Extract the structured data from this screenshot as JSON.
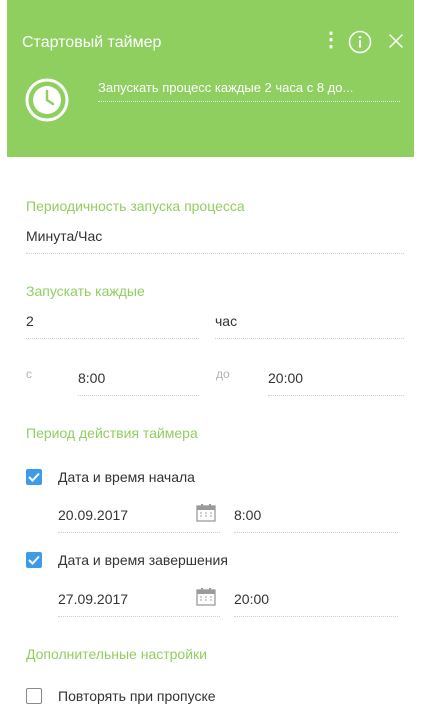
{
  "header": {
    "title": "Стартовый таймер",
    "description": "Запускать процесс каждые 2 часа с 8 до..."
  },
  "frequency": {
    "label": "Периодичность запуска процесса",
    "value": "Минута/Час"
  },
  "run_every": {
    "label": "Запускать каждые",
    "value": "2",
    "unit": "час",
    "from_label": "с",
    "from_value": "8:00",
    "to_label": "до",
    "to_value": "20:00"
  },
  "period": {
    "label": "Период действия таймера",
    "start": {
      "label": "Дата и время начала",
      "checked": true,
      "date": "20.09.2017",
      "time": "8:00"
    },
    "end": {
      "label": "Дата и время завершения",
      "checked": true,
      "date": "27.09.2017",
      "time": "20:00"
    }
  },
  "extra": {
    "label": "Дополнительные настройки",
    "repeat": {
      "label": "Повторять при пропуске",
      "checked": false
    }
  },
  "colors": {
    "header_bg": "#8fcf60",
    "accent": "#8fcf60",
    "checkbox": "#3d9be9"
  },
  "icons": [
    "timer-icon",
    "more-vertical-icon",
    "info-icon",
    "close-icon",
    "calendar-icon",
    "check-icon"
  ]
}
